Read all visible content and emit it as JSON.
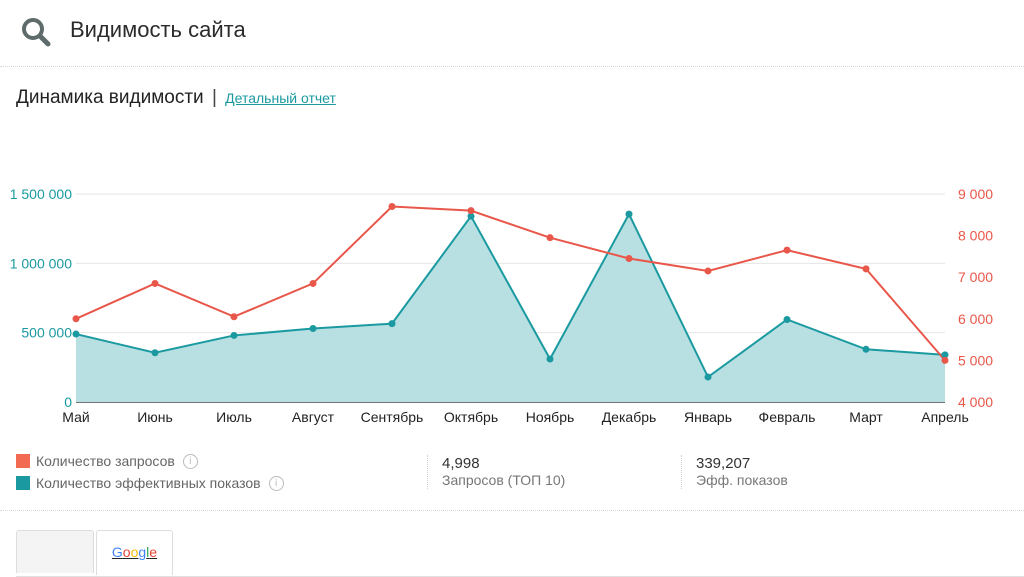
{
  "header": {
    "title": "Видимость сайта",
    "icon": "search-icon"
  },
  "section": {
    "title": "Динамика видимости",
    "separator": "|",
    "link_label": "Детальный отчет"
  },
  "chart_data": {
    "type": "line",
    "categories": [
      "Май",
      "Июнь",
      "Июль",
      "Август",
      "Сентябрь",
      "Октябрь",
      "Ноябрь",
      "Декабрь",
      "Январь",
      "Февраль",
      "Март",
      "Апрель"
    ],
    "series": [
      {
        "name": "Количество запросов",
        "axis": "right",
        "color": "#e8574a",
        "values": [
          6000,
          6850,
          6050,
          6850,
          8700,
          8600,
          7950,
          7450,
          7150,
          7650,
          7200,
          5000
        ]
      },
      {
        "name": "Количество эффективных показов",
        "axis": "left",
        "color": "#1a9aa0",
        "fill": "#b8e0e2",
        "values": [
          490000,
          355000,
          480000,
          530000,
          565000,
          1340000,
          310000,
          1355000,
          180000,
          595000,
          380000,
          340000
        ]
      }
    ],
    "y_left": {
      "ticks": [
        "0",
        "500 000",
        "1 000 000",
        "1 500 000"
      ],
      "range": [
        0,
        1500000
      ]
    },
    "y_right": {
      "ticks": [
        "4 000",
        "5 000",
        "6 000",
        "7 000",
        "8 000",
        "9 000"
      ],
      "range": [
        4000,
        9000
      ]
    },
    "grid": true
  },
  "legend": [
    {
      "label": "Количество запросов",
      "color": "#f36a52"
    },
    {
      "label": "Количество эффективных показов",
      "color": "#1a9aa0"
    }
  ],
  "stats": [
    {
      "value": "4,998",
      "label": "Запросов (ТОП 10)"
    },
    {
      "value": "339,207",
      "label": "Эфф. показов"
    }
  ],
  "tabs": [
    {
      "label": ""
    },
    {
      "label": "Google"
    }
  ],
  "colors": {
    "accent": "#1a9aa0",
    "red": "#e8574a",
    "google": [
      "#4285f4",
      "#ea4335",
      "#fbbc05",
      "#4285f4",
      "#34a853",
      "#ea4335"
    ]
  }
}
